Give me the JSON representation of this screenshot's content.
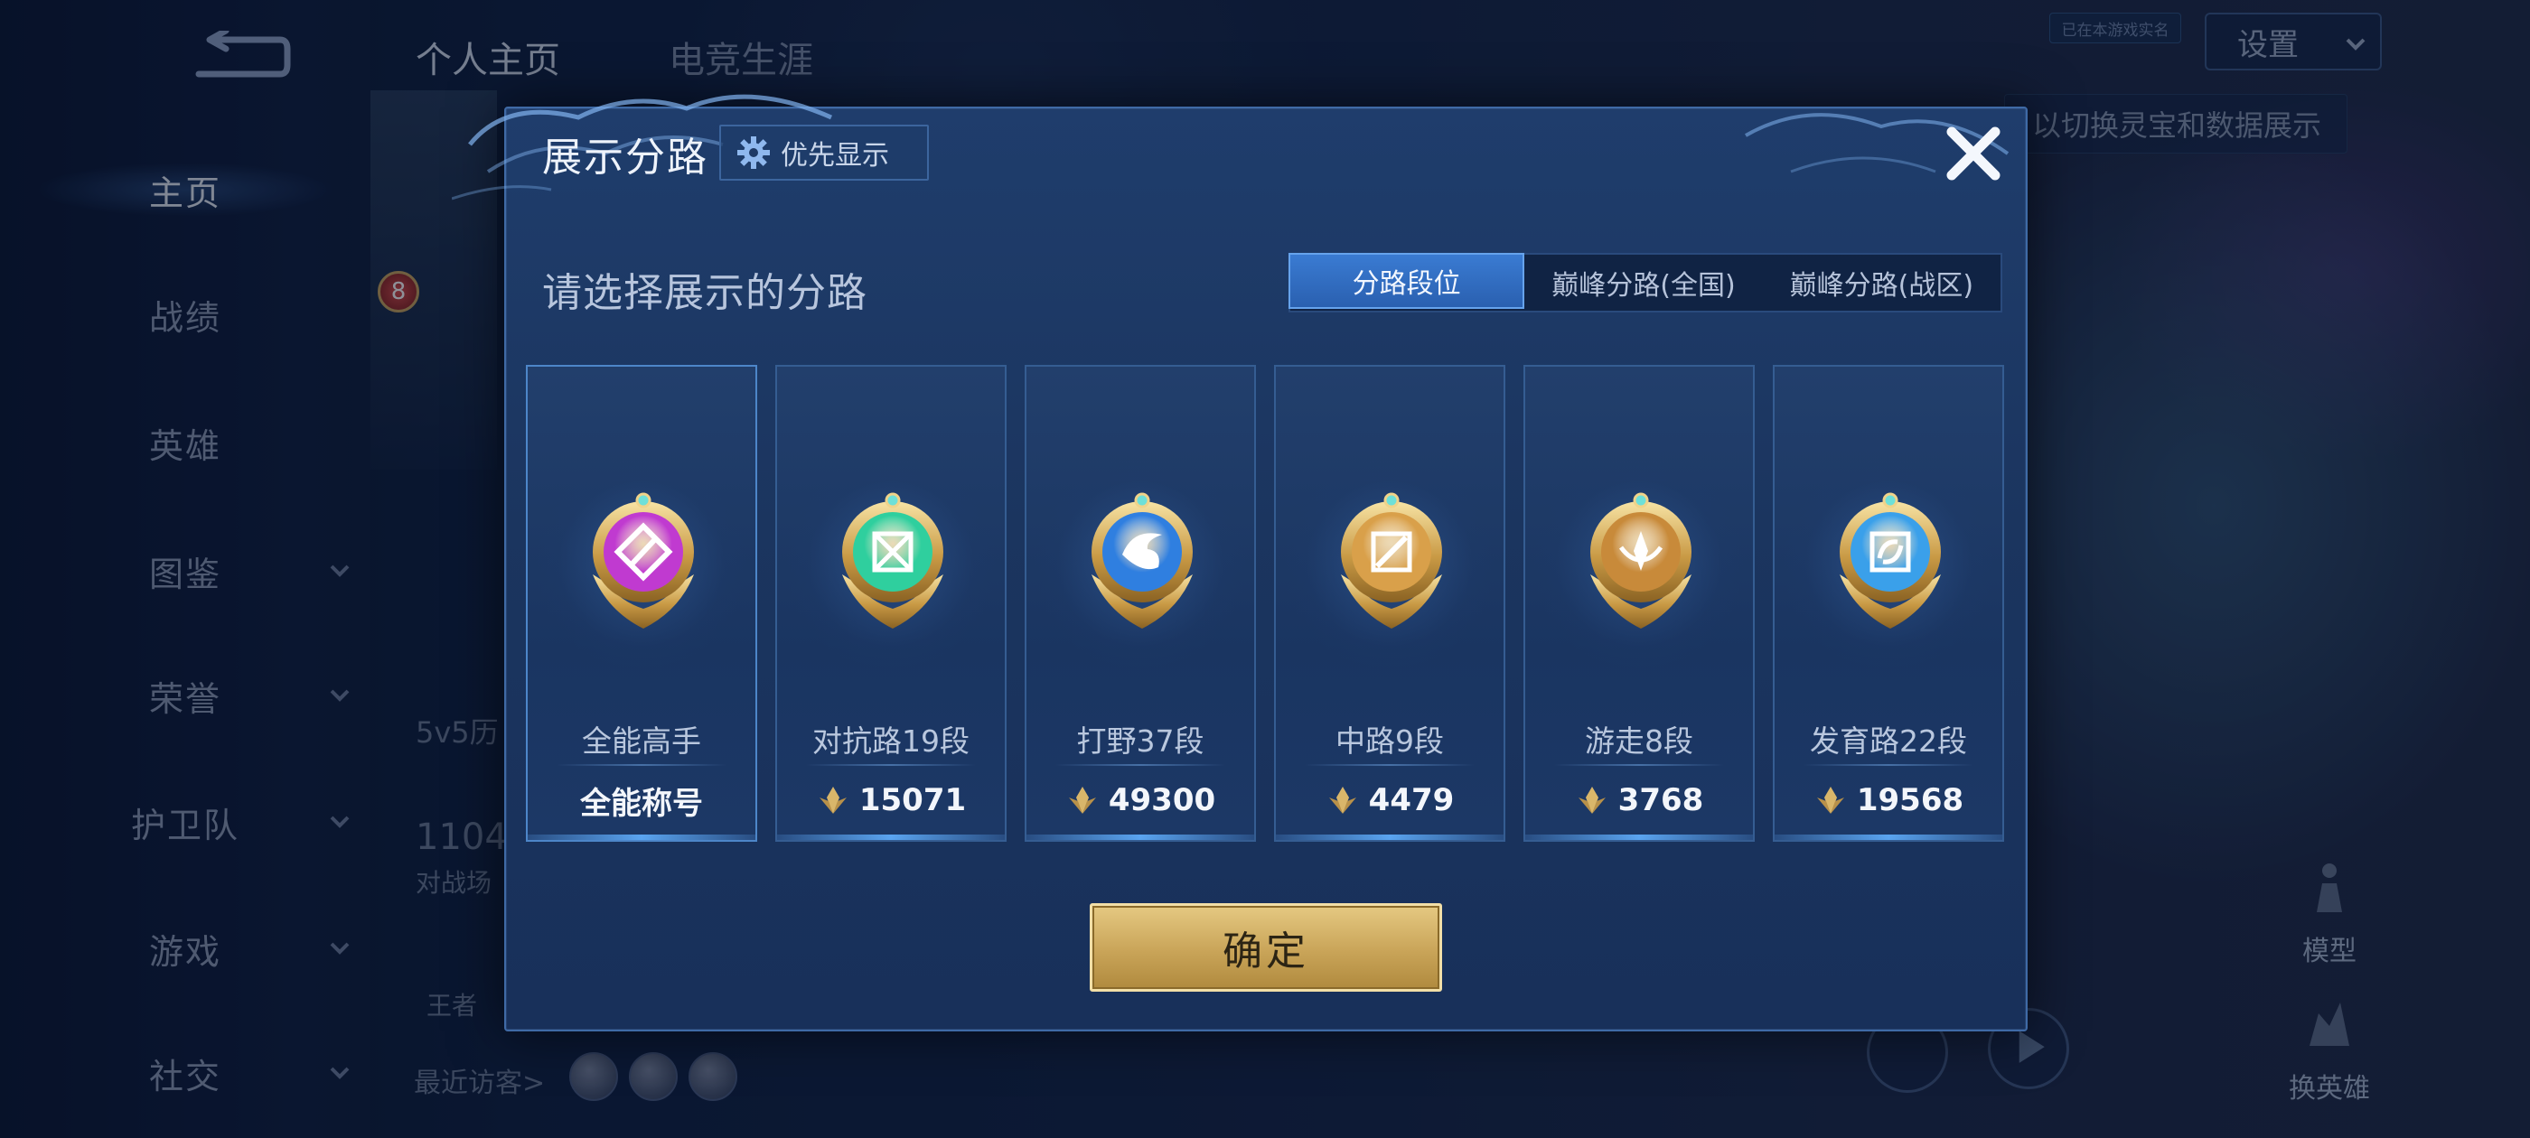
{
  "background": {
    "sidebar": {
      "items": [
        {
          "label": "主页",
          "active": true,
          "has_chevron": false
        },
        {
          "label": "战绩",
          "active": false,
          "has_chevron": false
        },
        {
          "label": "英雄",
          "active": false,
          "has_chevron": false
        },
        {
          "label": "图鉴",
          "active": false,
          "has_chevron": true
        },
        {
          "label": "荣誉",
          "active": false,
          "has_chevron": true
        },
        {
          "label": "护卫队",
          "active": false,
          "has_chevron": true
        },
        {
          "label": "游戏",
          "active": false,
          "has_chevron": true
        },
        {
          "label": "社交",
          "active": false,
          "has_chevron": true
        }
      ]
    },
    "tabs": [
      {
        "label": "个人主页",
        "active": true
      },
      {
        "label": "电竞生涯",
        "active": false
      }
    ],
    "settings_label": "设置",
    "realname_badge": "已在本游戏实名",
    "hint_text": "以切换灵宝和数据展示",
    "level_number": "8",
    "history_text": "5v5历",
    "count_text": "1104",
    "count_caption": "对战场",
    "king_text": "王者",
    "visitors_label": "最近访客>",
    "side_buttons": {
      "model": "模型",
      "switch_hero": "换英雄"
    }
  },
  "modal": {
    "title": "展示分路",
    "priority_label": "优先显示",
    "subtitle": "请选择展示的分路",
    "tabs": [
      {
        "label": "分路段位",
        "active": true
      },
      {
        "label": "巅峰分路(全国)",
        "active": false
      },
      {
        "label": "巅峰分路(战区)",
        "active": false
      }
    ],
    "cards": [
      {
        "name": "全能高手",
        "value": "全能称号",
        "has_points_icon": false,
        "medal": "allround",
        "color": "#c03ad0"
      },
      {
        "name": "对抗路19段",
        "value": "15071",
        "has_points_icon": true,
        "medal": "clash",
        "color": "#2fcf9e"
      },
      {
        "name": "打野37段",
        "value": "49300",
        "has_points_icon": true,
        "medal": "jungle",
        "color": "#2f7fe0"
      },
      {
        "name": "中路9段",
        "value": "4479",
        "has_points_icon": true,
        "medal": "mid",
        "color": "#d9a04a"
      },
      {
        "name": "游走8段",
        "value": "3768",
        "has_points_icon": true,
        "medal": "roam",
        "color": "#c88a3a"
      },
      {
        "name": "发育路22段",
        "value": "19568",
        "has_points_icon": true,
        "medal": "farm",
        "color": "#3aa0ea"
      }
    ],
    "confirm_label": "确定"
  },
  "colors": {
    "modal_bg": "#1f3d6c",
    "accent_blue": "#3a7bd2",
    "confirm_gold": "#c9a458"
  }
}
